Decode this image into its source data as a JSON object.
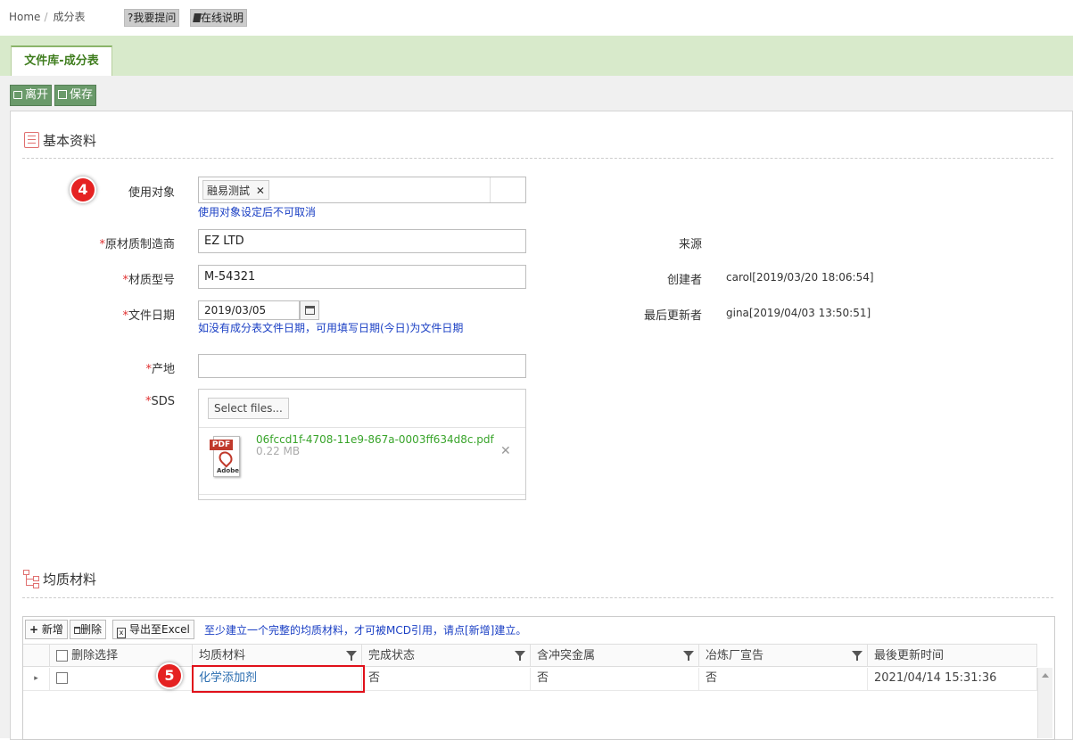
{
  "breadcrumb": {
    "home": "Home",
    "separator": "/",
    "current": "成分表"
  },
  "help": {
    "ask": "?我要提问",
    "docs": "在线说明"
  },
  "tab": {
    "label": "文件库-成分表"
  },
  "toolbar": {
    "leave": "离开",
    "save": "保存"
  },
  "basic": {
    "title": "基本资料",
    "target_label": "使用对象",
    "target_tag": "融易测試",
    "target_hint": "使用对象设定后不可取消",
    "manufacturer_label": "原材质制造商",
    "manufacturer_value": "EZ LTD",
    "model_label": "材质型号",
    "model_value": "M-54321",
    "docdate_label": "文件日期",
    "docdate_value": "2019/03/05",
    "docdate_hint": "如没有成分表文件日期，可用填写日期(今日)为文件日期",
    "origin_label": "产地",
    "origin_value": "",
    "sds_label": "SDS",
    "select_files": "Select files...",
    "file_name": "06fccd1f-4708-11e9-867a-0003ff634d8c.pdf",
    "file_size": "0.22 MB",
    "pdf_icon_text": "PDF",
    "pdf_brand": "Adobe",
    "required_mark": "*",
    "source_label": "来源",
    "creator_label": "创建者",
    "creator_value": "carol[2019/03/20 18:06:54]",
    "updater_label": "最后更新者",
    "updater_value": "gina[2019/04/03 13:50:51]"
  },
  "materials": {
    "title": "均质材料",
    "add": "新增",
    "delete": "删除",
    "export": "导出至Excel",
    "notice": "至少建立一个完整的均质材料，才可被MCD引用，请点[新增]建立。",
    "columns": [
      "删除选择",
      "均质材料",
      "完成状态",
      "含冲突金属",
      "冶炼厂宣告",
      "最後更新时间"
    ],
    "rows": [
      {
        "material": "化学添加剂",
        "complete": "否",
        "conflict": "否",
        "smelter": "否",
        "updated": "2021/04/14 15:31:36"
      }
    ]
  },
  "badges": {
    "b4": "4",
    "b5": "5"
  },
  "colors": {
    "accent_green": "#3f7d1e",
    "band": "#d8eacb",
    "hint_blue": "#1a3fc4",
    "badge_red": "#e52222",
    "highlight": "#e0101a"
  }
}
